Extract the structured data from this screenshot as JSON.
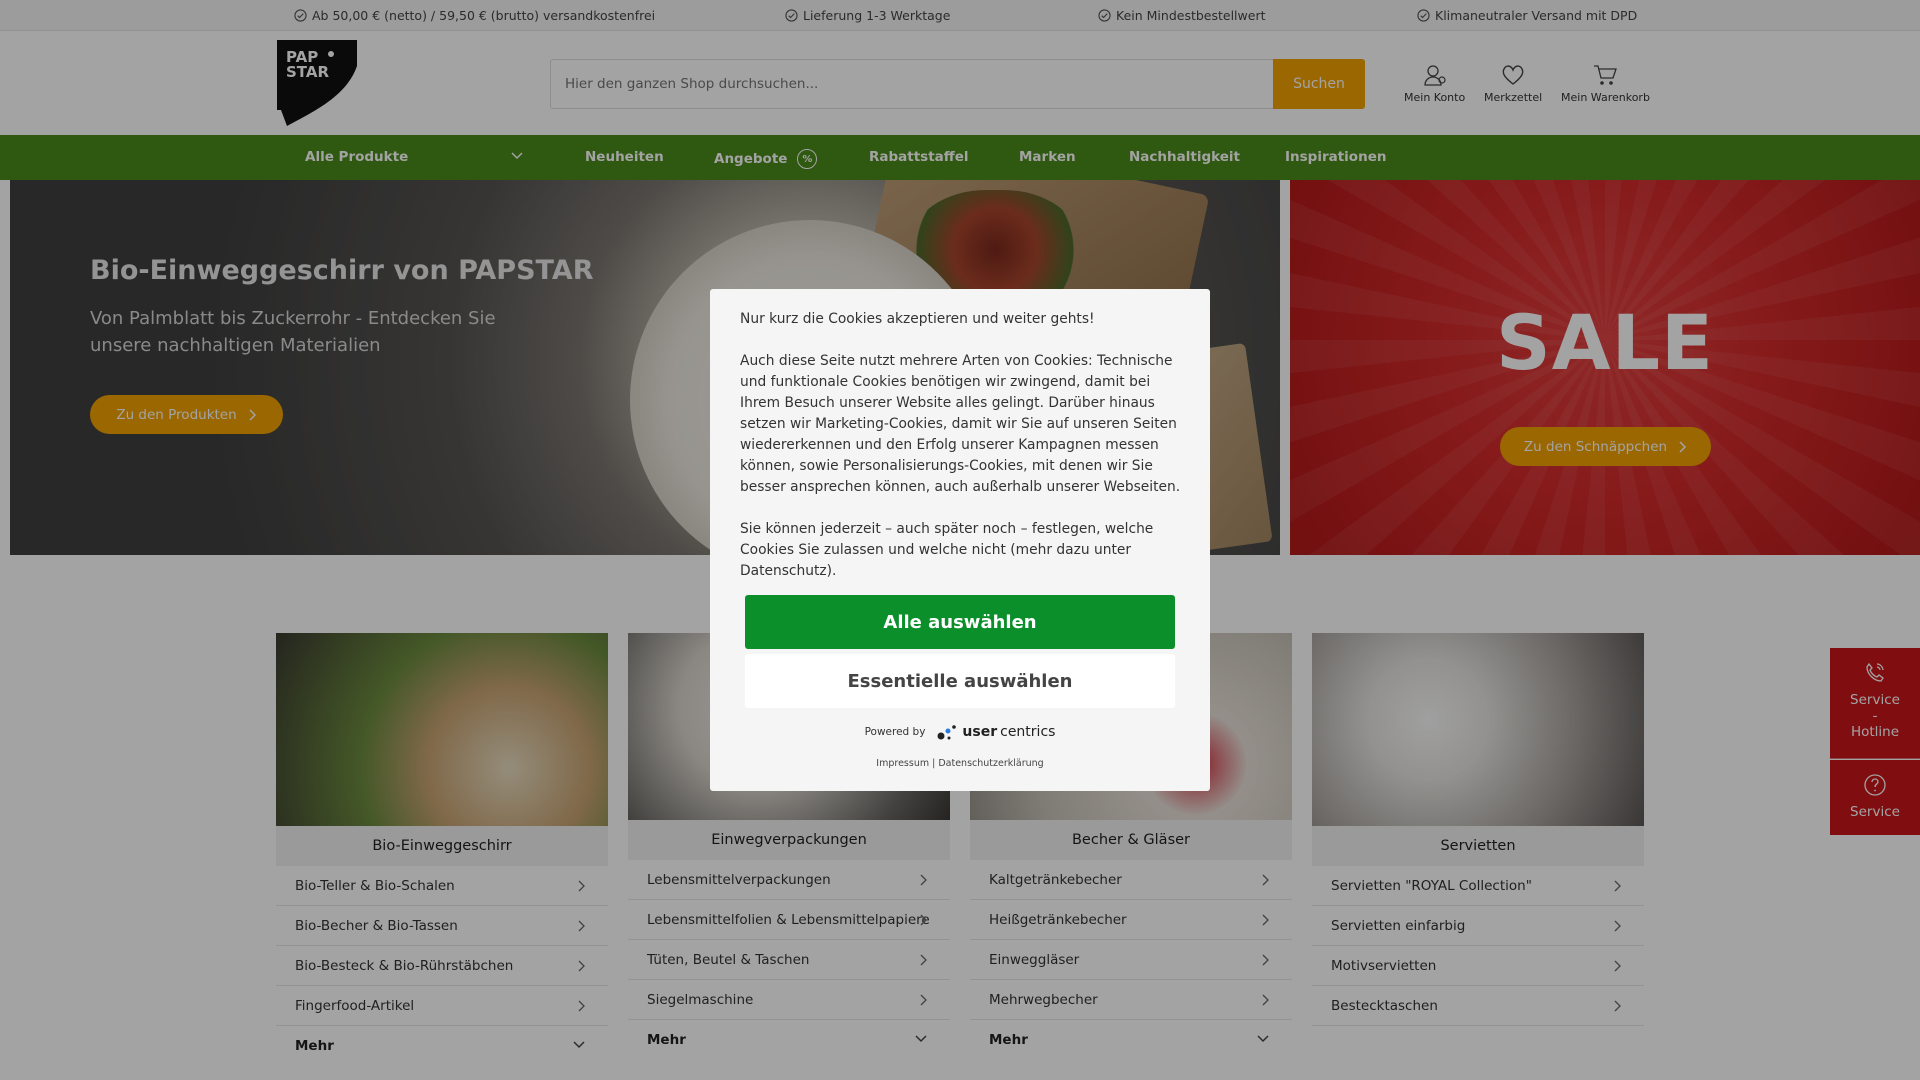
{
  "usp": [
    {
      "text": "Ab 50,00 € (netto) / 59,50 € (brutto) versandkostenfrei",
      "icon": "check-circle-icon"
    },
    {
      "text": "Lieferung 1-3 Werktage",
      "icon": "check-circle-icon"
    },
    {
      "text": "Kein Mindestbestellwert",
      "icon": "check-circle-icon"
    },
    {
      "text": "Klimaneutraler Versand mit DPD",
      "icon": "check-circle-icon"
    }
  ],
  "header": {
    "logo_text_1": "PAP",
    "logo_text_2": "STAR",
    "search_placeholder": "Hier den ganzen Shop durchsuchen...",
    "search_button": "Suchen",
    "account_label": "Mein Konto",
    "wishlist_label": "Merkzettel",
    "cart_label": "Mein Warenkorb"
  },
  "nav": {
    "items": [
      "Alle Produkte",
      "Neuheiten",
      "Angebote",
      "Rabattstaffel",
      "Marken",
      "Nachhaltigkeit",
      "Inspirationen"
    ]
  },
  "hero": {
    "title": "Bio-Einweggeschirr von PAPSTAR",
    "subtitle": "Von Palmblatt bis Zuckerrohr - Entdecken Sie unsere nachhaltigen Materialien",
    "button": "Zu den Produkten",
    "sale_title": "SALE",
    "sale_button": "Zu den Schnäppchen"
  },
  "categories": [
    {
      "title": "Bio-Einweggeschirr",
      "links": [
        "Bio-Teller & Bio-Schalen",
        "Bio-Becher & Bio-Tassen",
        "Bio-Besteck & Bio-Rührstäbchen",
        "Fingerfood-Artikel"
      ],
      "more": "Mehr"
    },
    {
      "title": "Einwegverpackungen",
      "links": [
        "Lebensmittelverpackungen",
        "Lebensmittelfolien & Lebensmittelpapiere",
        "Tüten, Beutel & Taschen",
        "Siegelmaschine"
      ],
      "more": "Mehr"
    },
    {
      "title": "Becher & Gläser",
      "links": [
        "Kaltgetränkebecher",
        "Heißgetränkebecher",
        "Einweggläser",
        "Mehrwegbecher"
      ],
      "more": "Mehr"
    },
    {
      "title": "Servietten",
      "links": [
        "Servietten \"ROYAL Collection\"",
        "Servietten einfarbig",
        "Motivservietten",
        "Bestecktaschen"
      ],
      "more": ""
    }
  ],
  "service": {
    "hotline_line1": "Service",
    "hotline_line2": "-",
    "hotline_line3": "Hotline",
    "service_label": "Service"
  },
  "cookie": {
    "intro": "Nur kurz die Cookies akzeptieren und weiter gehts!",
    "body": "Auch diese Seite nutzt mehrere Arten von Cookies: Technische und funktionale Cookies benötigen wir zwingend, damit bei Ihrem Besuch unserer Website alles gelingt. Darüber hinaus setzen wir Marketing-Cookies, damit wir Sie auf unseren Seiten wiedererkennen und den Erfolg unserer Kampagnen messen können, sowie Personalisierungs-Cookies, mit denen wir Sie besser ansprechen können, auch außerhalb unserer Webseiten.",
    "note": "Sie können jederzeit – auch später noch – festlegen, welche Cookies Sie zulassen und welche nicht (mehr dazu unter Datenschutz).",
    "accept_all": "Alle auswählen",
    "essential": "Essentielle auswählen",
    "powered_by": "Powered by",
    "brand_user": "user",
    "brand_centrics": "centrics",
    "legal": "Impressum | Datenschutzerklärung"
  },
  "colors": {
    "nav_green": "#4a8a1a",
    "accent_orange": "#f2a200",
    "sale_red": "#d32a2a",
    "accept_green": "#0a8f2a"
  }
}
